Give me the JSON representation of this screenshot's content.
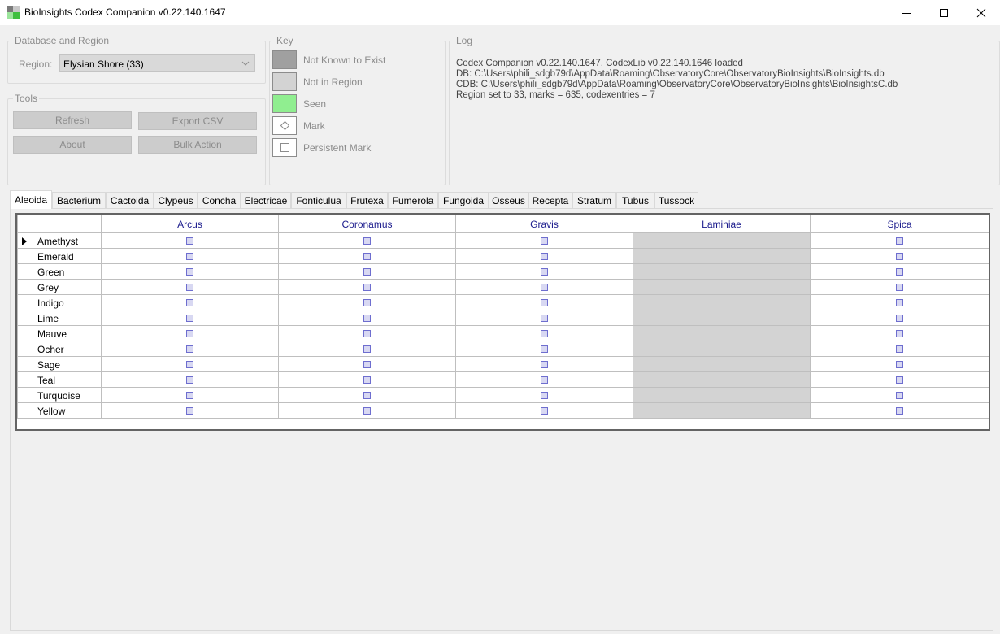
{
  "window": {
    "title": "BioInsights Codex Companion v0.22.140.1647",
    "icon": "app-logo-icon",
    "controls": [
      "minimize-icon",
      "maximize-icon",
      "close-icon"
    ]
  },
  "database_group": {
    "legend": "Database and Region",
    "region_label": "Region:",
    "region_value": "Elysian Shore (33)"
  },
  "tools_group": {
    "legend": "Tools",
    "buttons": {
      "refresh": "Refresh",
      "export_csv": "Export CSV",
      "about": "About",
      "bulk_action": "Bulk Action"
    }
  },
  "key_group": {
    "legend": "Key",
    "items": [
      {
        "label": "Not Known to Exist",
        "color": "#a0a0a0"
      },
      {
        "label": "Not in Region",
        "color": "#d3d3d3"
      },
      {
        "label": "Seen",
        "color": "#90ee90"
      },
      {
        "label": "Mark",
        "symbol": "◇"
      },
      {
        "label": "Persistent Mark",
        "symbol": "□"
      }
    ]
  },
  "log_group": {
    "legend": "Log",
    "lines": [
      "Codex Companion v0.22.140.1647, CodexLib v0.22.140.1646 loaded",
      "DB: C:\\Users\\phili_sdgb79d\\AppData\\Roaming\\ObservatoryCore\\ObservatoryBioInsights\\BioInsights.db",
      "CDB: C:\\Users\\phili_sdgb79d\\AppData\\Roaming\\ObservatoryCore\\ObservatoryBioInsights\\BioInsightsC.db",
      "Region set to 33, marks = 635, codexentries = 7"
    ]
  },
  "tabs": [
    "Aleoida",
    "Bacterium",
    "Cactoida",
    "Clypeus",
    "Concha",
    "Electricae",
    "Fonticulua",
    "Frutexa",
    "Fumerola",
    "Fungoida",
    "Osseus",
    "Recepta",
    "Stratum",
    "Tubus",
    "Tussock"
  ],
  "active_tab": "Aleoida",
  "grid": {
    "columns": [
      "Arcus",
      "Coronamus",
      "Gravis",
      "Laminiae",
      "Spica"
    ],
    "unavailable_column": "Laminiae",
    "rows": [
      "Amethyst",
      "Emerald",
      "Green",
      "Grey",
      "Indigo",
      "Lime",
      "Mauve",
      "Ocher",
      "Sage",
      "Teal",
      "Turquoise",
      "Yellow"
    ],
    "selected_row": "Amethyst",
    "header_color": "#1a1a8c",
    "unavailable_color": "#d3d3d3"
  }
}
